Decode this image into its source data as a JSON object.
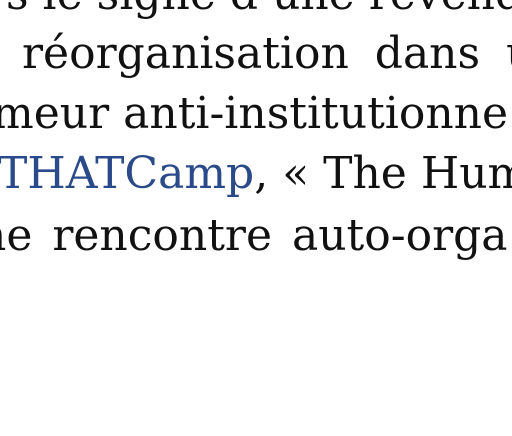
{
  "document": {
    "lines": [
      "s le signe d’une revendi",
      "réorganisation dans u",
      "meur anti-institutionne",
      "THATCamp",
      ", « The Hum",
      "ne rencontre auto-orga"
    ],
    "link_color": "#2a4a8a",
    "text_color": "#111111"
  }
}
